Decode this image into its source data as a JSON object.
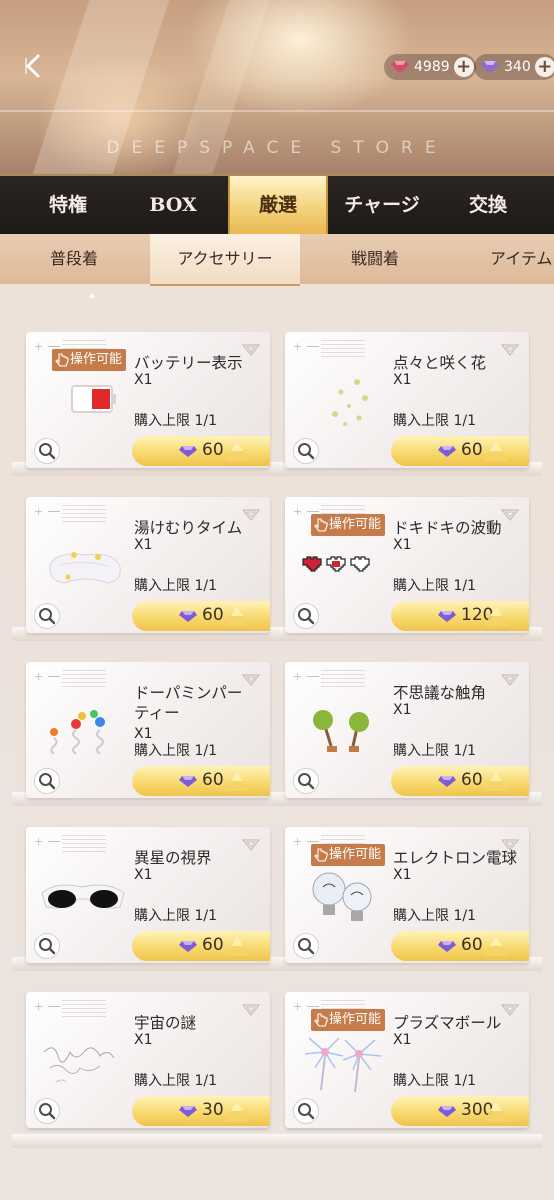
{
  "header": {
    "store_title": "DEEPSPACE STORE",
    "currency": [
      {
        "icon": "red-diamond-icon",
        "value": "4989"
      },
      {
        "icon": "purple-diamond-icon",
        "value": "340"
      }
    ]
  },
  "main_tabs": [
    {
      "label": "特権"
    },
    {
      "label": "BOX"
    },
    {
      "label": "厳選",
      "active": true
    },
    {
      "label": "チャージ"
    },
    {
      "label": "交換"
    }
  ],
  "sub_tabs": [
    {
      "label": "普段着"
    },
    {
      "label": "アクセサリー",
      "active": true
    },
    {
      "label": "戦闘着"
    },
    {
      "label": "アイテム"
    }
  ],
  "badge_label": "操作可能",
  "items": [
    {
      "name": "バッテリー表示",
      "qty": "X1",
      "limit": "購入上限 1/1",
      "price": "60",
      "badge": true,
      "icon": "battery-icon"
    },
    {
      "name": "点々と咲く花",
      "qty": "X1",
      "limit": "購入上限 1/1",
      "price": "60",
      "badge": false,
      "icon": "flower-sparkles-icon"
    },
    {
      "name": "湯けむりタイム",
      "qty": "X1",
      "limit": "購入上限 1/1",
      "price": "60",
      "badge": false,
      "icon": "towel-headband-icon"
    },
    {
      "name": "ドキドキの波動",
      "qty": "X1",
      "limit": "購入上限 1/1",
      "price": "120",
      "badge": true,
      "icon": "pixel-hearts-icon"
    },
    {
      "name": "ドーパミンパーティー",
      "qty": "X1",
      "limit": "購入上限 1/1",
      "price": "60",
      "badge": false,
      "icon": "butterfly-springs-icon"
    },
    {
      "name": "不思議な触角",
      "qty": "X1",
      "limit": "購入上限 1/1",
      "price": "60",
      "badge": false,
      "icon": "antenna-icon"
    },
    {
      "name": "異星の視界",
      "qty": "X1",
      "limit": "購入上限 1/1",
      "price": "60",
      "badge": false,
      "icon": "sunglasses-icon"
    },
    {
      "name": "エレクトロン電球",
      "qty": "X1",
      "limit": "購入上限 1/1",
      "price": "60",
      "badge": true,
      "icon": "lightbulb-icon"
    },
    {
      "name": "宇宙の謎",
      "qty": "X1",
      "limit": "購入上限 1/1",
      "price": "30",
      "badge": false,
      "icon": "handwriting-icon"
    },
    {
      "name": "プラズマボール",
      "qty": "X1",
      "limit": "購入上限 1/1",
      "price": "300",
      "badge": true,
      "icon": "plasma-ball-icon"
    }
  ]
}
